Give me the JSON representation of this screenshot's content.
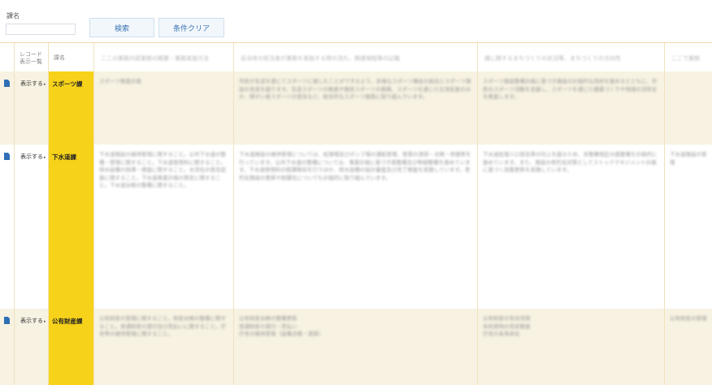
{
  "search": {
    "field_label": "課名",
    "field_value": "",
    "search_button": "検索",
    "clear_button": "条件クリア"
  },
  "table": {
    "header": {
      "detail_label": "レコード\n表示一覧",
      "name_label": "課名",
      "col3": "ここの業務内容業務の概要・業務実施方法",
      "col4": "自治体の担当者が業務を実施する際の流れ、関連規程等の記載",
      "col5": "課に関するまちづくりの状況等、まちづくりの方向性",
      "col6": "ここで業務"
    },
    "show_label": "表示する",
    "rows": [
      {
        "name": "スポーツ課",
        "col3": "スポーツ推進計画",
        "col4": "市民が生涯を通じてスポーツに親しむことができるよう、多様なスポーツ機会の創出とスポーツ施設の充実を図ります。生涯スポーツの推進や競技スポーツの振興、スポーツを通じた交流促進のほか、障がい者スポーツの普及など、総合的なスポーツ施策に取り組んでいます。",
        "col5": "スポーツ施設整備計画に基づき施設の計画的な改修を進めるとともに、市民のスポーツ活動を支援し、スポーツを通じた健康づくりや地域の活性化を推進します。",
        "col6": ""
      },
      {
        "name": "下水道課",
        "col3": "下水道施設の維持管理に関すること。公共下水道の整備・管理に関すること。下水道使用料に関すること。排水設備の指導・検査に関すること。水洗化の普及促進に関すること。下水道事業計画の策定に関すること。下水道台帳の整備に関すること。",
        "col4": "下水道施設の維持管理については、処理場及びポンプ場の運転管理、管渠の清掃・点検・修繕等を行っています。公共下水道の整備については、事業計画に基づき面整備及び幹線整備を進めています。下水道使用料の賦課徴収を行うほか、排水設備の設計審査及び完了検査を実施しています。老朽化施設の更新や耐震化についても計画的に取り組んでいます。",
        "col5": "下水道処理人口普及率の向上を図るため、未整備地区の面整備を計画的に進めています。また、施設の老朽化対策としてストックマネジメント計画に基づく改築更新を実施しています。",
        "col6": "下水道施設の管理"
      },
      {
        "name": "公有財産課",
        "col3": "公有財産の管理に関すること。財産台帳の整備に関すること。普通財産の貸付及び売払いに関すること。庁舎等の維持管理に関すること。",
        "col4": "公有財産台帳の整備更新\n普通財産の貸付・売払い\n庁舎の維持管理（設備点検・清掃）",
        "col5": "公有財産の有効活用\n未利用地の売却推進\n庁舎の長寿命化",
        "col6": "公有財産の管理"
      }
    ]
  }
}
